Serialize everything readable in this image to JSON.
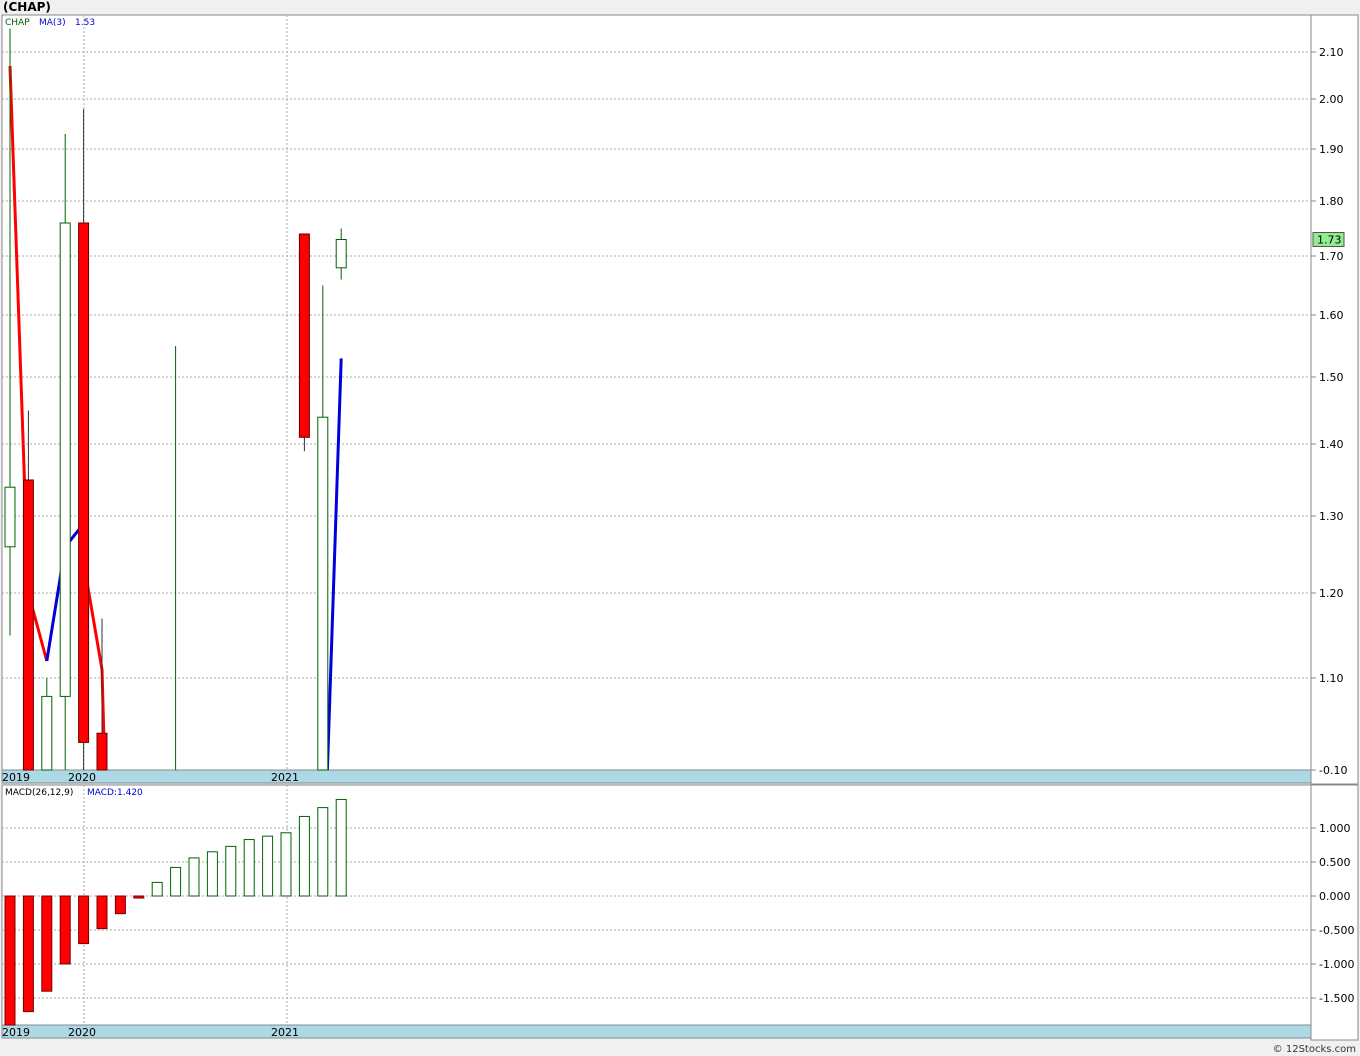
{
  "title": "(CHAP)",
  "footer": "© 12Stocks.com",
  "colors": {
    "up": "#006400",
    "down": "#ff0000",
    "ma": "#0000dd",
    "axis_band": "#add8e6",
    "last_bg": "#90ee90"
  },
  "chart_data": [
    {
      "type": "candlestick",
      "legend": [
        {
          "label": "CHAP",
          "value": "",
          "color": "#006400"
        },
        {
          "label": "MA(3)",
          "value": "1.53",
          "color": "#0000dd"
        }
      ],
      "last_price": "1.73",
      "y_ticks": [
        "2.10",
        "2.00",
        "1.90",
        "1.80",
        "1.70",
        "1.60",
        "1.50",
        "1.40",
        "1.30",
        "1.20",
        "1.10",
        "-0.10"
      ],
      "x_labels": [
        "2019",
        "2020",
        "2021"
      ],
      "candles": [
        {
          "open": 1.26,
          "close": 1.34,
          "high": 2.15,
          "low": 1.15
        },
        {
          "open": 1.35,
          "close": -0.1,
          "high": 1.45,
          "low": -0.1
        },
        {
          "open": -0.1,
          "close": 1.08,
          "high": 1.1,
          "low": -0.1
        },
        {
          "open": 1.08,
          "close": 1.76,
          "high": 1.93,
          "low": -0.1
        },
        {
          "open": 1.76,
          "close": 1.03,
          "high": 1.98,
          "low": -0.1
        },
        {
          "open": 1.04,
          "close": -0.1,
          "high": 1.17,
          "low": -0.1
        },
        null,
        null,
        null,
        {
          "open": -0.1,
          "close": -0.1,
          "high": 1.55,
          "low": -0.1
        },
        null,
        null,
        null,
        null,
        null,
        null,
        {
          "open": 1.74,
          "close": 1.41,
          "high": 1.74,
          "low": 1.39
        },
        {
          "open": -0.1,
          "close": 1.44,
          "high": 1.65,
          "low": -0.1
        },
        {
          "open": 1.68,
          "close": 1.73,
          "high": 1.75,
          "low": 1.66
        }
      ],
      "ma_segments": [
        {
          "color": "down",
          "points": [
            [
              0,
              2.07
            ],
            [
              1,
              1.2
            ],
            [
              2,
              1.12
            ]
          ]
        },
        {
          "color": "up",
          "points": [
            [
              2,
              1.12
            ],
            [
              3,
              1.26
            ],
            [
              4,
              1.29
            ]
          ]
        },
        {
          "color": "down",
          "points": [
            [
              4,
              1.24
            ],
            [
              5,
              1.11
            ],
            [
              5.15,
              -0.1
            ]
          ]
        },
        {
          "color": "up",
          "points": [
            [
              17.25,
              -0.1
            ],
            [
              18,
              1.53
            ]
          ]
        }
      ]
    },
    {
      "type": "bar",
      "legend": [
        {
          "label": "MACD(26,12,9)",
          "value": "",
          "color": "#000000"
        },
        {
          "label": "MACD:1.420",
          "value": "",
          "color": "#0000dd"
        }
      ],
      "y_ticks": [
        "1.000",
        "0.500",
        "0.000",
        "-0.500",
        "-1.000",
        "-1.500"
      ],
      "x_labels": [
        "2019",
        "2020",
        "2021"
      ],
      "values": [
        -1.9,
        -1.7,
        -1.4,
        -1.0,
        -0.7,
        -0.48,
        -0.26,
        -0.03,
        0.2,
        0.42,
        0.56,
        0.65,
        0.73,
        0.83,
        0.88,
        0.93,
        1.17,
        1.3,
        1.42
      ]
    }
  ]
}
